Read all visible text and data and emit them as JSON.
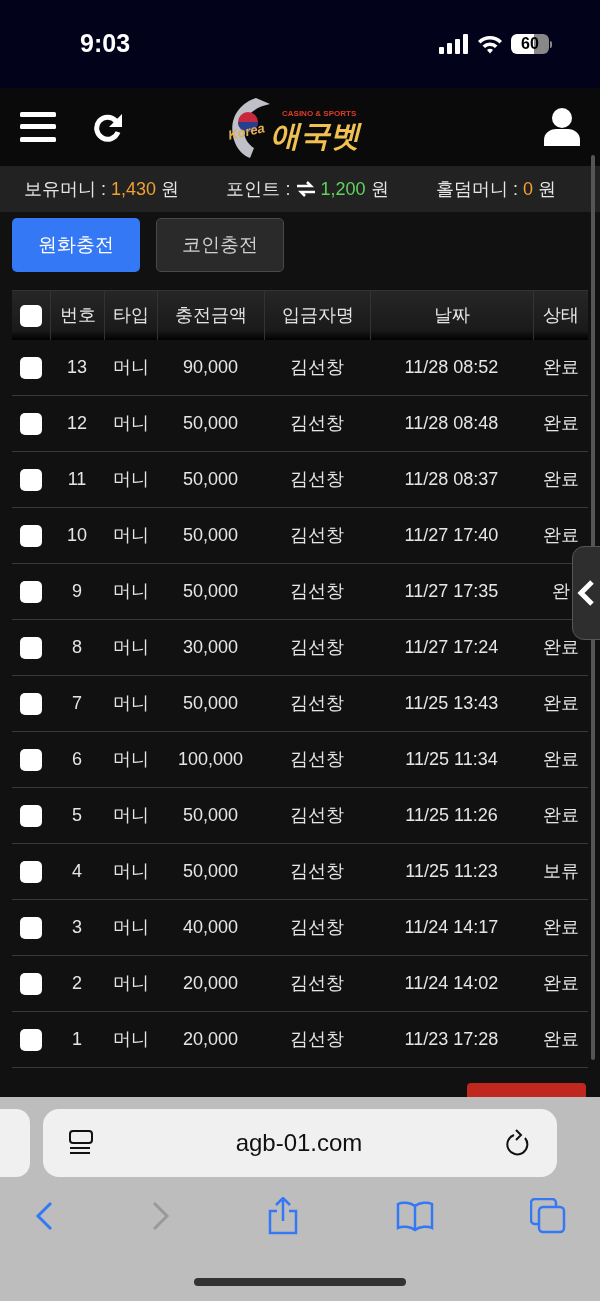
{
  "status_bar": {
    "time": "9:03",
    "battery": "60"
  },
  "header": {
    "logo": {
      "tagline": "CASINO & SPORTS",
      "emblem": "Korea",
      "name": "애국벳"
    }
  },
  "balances": [
    {
      "label": "보유머니 :",
      "value": "1,430",
      "unit": "원",
      "color": "#f0a030",
      "exchange": false
    },
    {
      "label": "포인트 :",
      "value": "1,200",
      "unit": "원",
      "color": "#5fd35f",
      "exchange": true
    },
    {
      "label": "홀덤머니 :",
      "value": "0",
      "unit": "원",
      "color": "#f0a030",
      "exchange": false
    }
  ],
  "tabs": [
    {
      "label": "원화충전",
      "selected": true
    },
    {
      "label": "코인충전",
      "selected": false
    }
  ],
  "table": {
    "select_all": {
      "checked": false
    },
    "columns": [
      "번호",
      "타입",
      "충전금액",
      "입금자명",
      "날짜",
      "상태"
    ],
    "rows": [
      {
        "checked": false,
        "cells": [
          "13",
          "머니",
          "90,000",
          "김선창",
          "11/28 08:52",
          "완료"
        ]
      },
      {
        "checked": false,
        "cells": [
          "12",
          "머니",
          "50,000",
          "김선창",
          "11/28 08:48",
          "완료"
        ]
      },
      {
        "checked": false,
        "cells": [
          "11",
          "머니",
          "50,000",
          "김선창",
          "11/28 08:37",
          "완료"
        ]
      },
      {
        "checked": false,
        "cells": [
          "10",
          "머니",
          "50,000",
          "김선창",
          "11/27 17:40",
          "완료"
        ]
      },
      {
        "checked": false,
        "cells": [
          "9",
          "머니",
          "50,000",
          "김선창",
          "11/27 17:35",
          "완"
        ]
      },
      {
        "checked": false,
        "cells": [
          "8",
          "머니",
          "30,000",
          "김선창",
          "11/27 17:24",
          "완료"
        ]
      },
      {
        "checked": false,
        "cells": [
          "7",
          "머니",
          "50,000",
          "김선창",
          "11/25 13:43",
          "완료"
        ]
      },
      {
        "checked": false,
        "cells": [
          "6",
          "머니",
          "100,000",
          "김선창",
          "11/25 11:34",
          "완료"
        ]
      },
      {
        "checked": false,
        "cells": [
          "5",
          "머니",
          "50,000",
          "김선창",
          "11/25 11:26",
          "완료"
        ]
      },
      {
        "checked": false,
        "cells": [
          "4",
          "머니",
          "50,000",
          "김선창",
          "11/25 11:23",
          "보류"
        ]
      },
      {
        "checked": false,
        "cells": [
          "3",
          "머니",
          "40,000",
          "김선창",
          "11/24 14:17",
          "완료"
        ]
      },
      {
        "checked": false,
        "cells": [
          "2",
          "머니",
          "20,000",
          "김선창",
          "11/24 14:02",
          "완료"
        ]
      },
      {
        "checked": false,
        "cells": [
          "1",
          "머니",
          "20,000",
          "김선창",
          "11/23 17:28",
          "완료"
        ]
      }
    ]
  },
  "browser": {
    "url": "agb-01.com"
  }
}
